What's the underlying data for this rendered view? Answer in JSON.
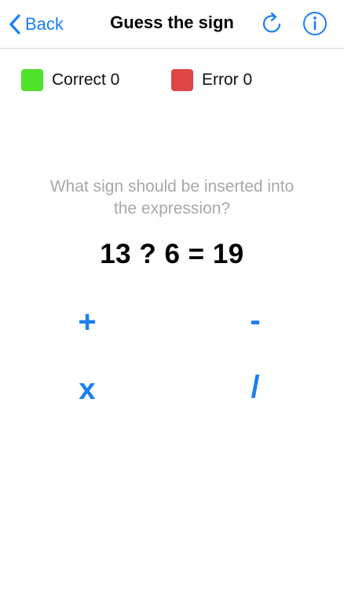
{
  "navbar": {
    "back_label": "Back",
    "title": "Guess the sign",
    "refresh_icon": "refresh-icon",
    "info_icon": "info-icon"
  },
  "score": {
    "correct_label": "Correct 0",
    "correct_color": "#4fe22b",
    "error_label": "Error 0",
    "error_color": "#e04545"
  },
  "question": {
    "line1": "What sign should be inserted into",
    "line2": "the expression?"
  },
  "expression": "13 ? 6 = 19",
  "answers": {
    "plus": "+",
    "minus": "-",
    "times": "x",
    "divide": "/"
  },
  "colors": {
    "accent": "#1a7ff5",
    "question_text": "#a8a8a8"
  }
}
